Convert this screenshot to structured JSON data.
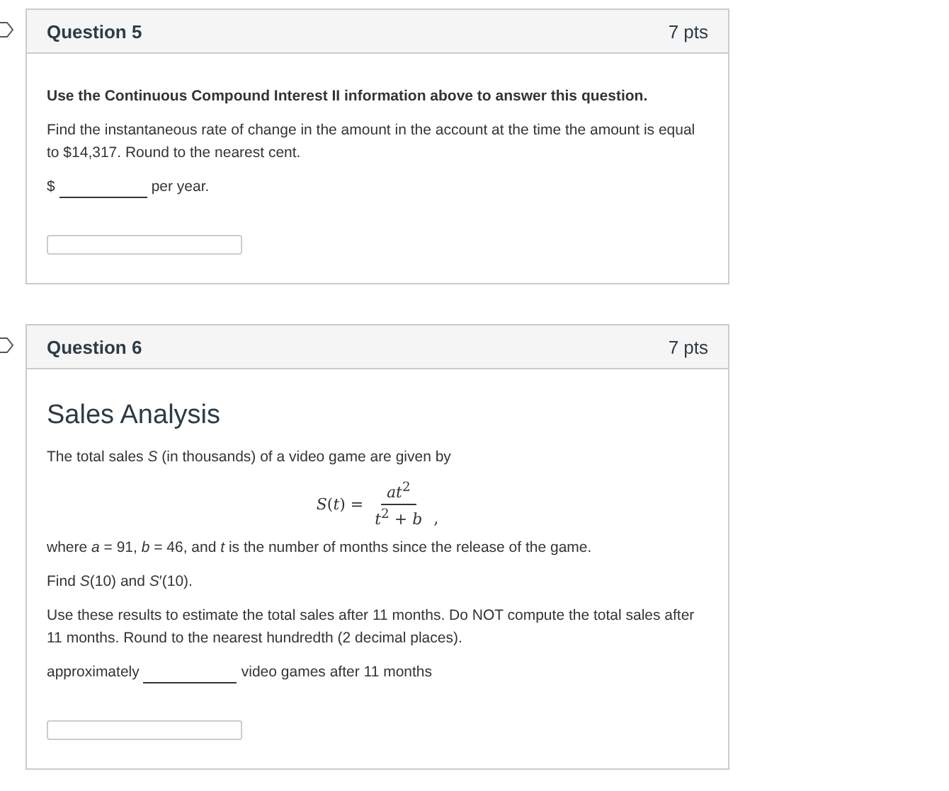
{
  "questions": [
    {
      "title": "Question 5",
      "points": "7 pts",
      "body": [
        {
          "kind": "bold",
          "text": "Use the Continuous Compound Interest II information above to answer this question."
        },
        {
          "kind": "text",
          "text": "Find the instantaneous rate of change in the amount in the account at the time the amount is equal to $14,317.  Round to the nearest cent."
        },
        {
          "kind": "blank",
          "before": "$",
          "after": "per year."
        }
      ]
    },
    {
      "title": "Question 6",
      "points": "7 pts",
      "body": [
        {
          "kind": "heading",
          "text": "Sales Analysis"
        },
        {
          "kind": "text",
          "text": "The total sales *S* (in thousands) of a video game are given by"
        },
        {
          "kind": "formula",
          "lhs": "*S*(*t*) =",
          "numerator": "*at*$^{2}$",
          "denominator": "*t*$^{2}$ + *b*",
          "tail": ","
        },
        {
          "kind": "text",
          "text": "where *a* = 91,  *b* = 46, and *t* is the number of months since the release of the game."
        },
        {
          "kind": "text",
          "text": "Find *S*(10) and *S*′(10)."
        },
        {
          "kind": "text",
          "text": "Use these results to estimate the total sales after 11 months.  Do NOT compute the total sales after 11 months.  Round to the nearest hundredth (2 decimal places)."
        },
        {
          "kind": "blank",
          "before": "approximately",
          "after": "video games after 11 months"
        }
      ]
    }
  ]
}
